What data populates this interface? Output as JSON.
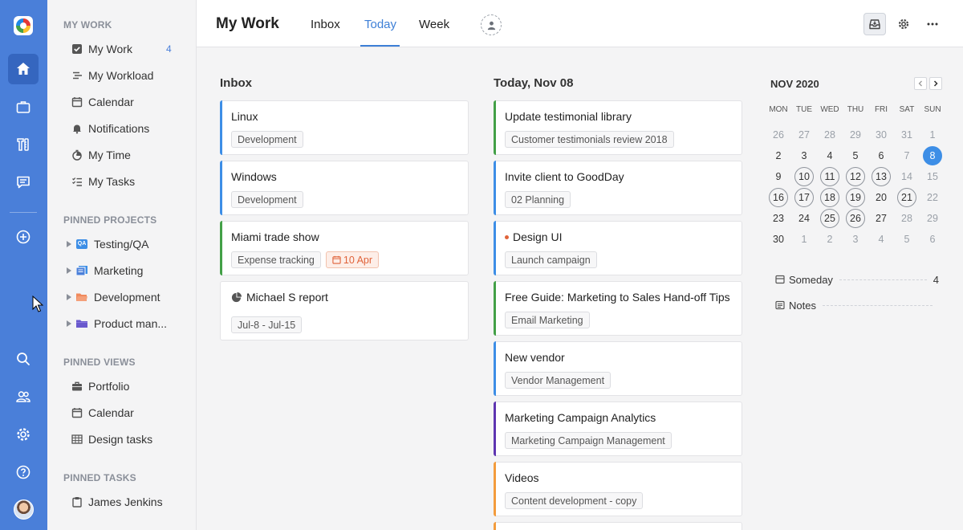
{
  "sidebar": {
    "my_work_header": "MY WORK",
    "my_work_items": [
      {
        "label": "My Work",
        "icon": "check-square-icon",
        "count": "4"
      },
      {
        "label": "My Workload",
        "icon": "workload-icon"
      },
      {
        "label": "Calendar",
        "icon": "calendar-icon"
      },
      {
        "label": "Notifications",
        "icon": "bell-icon"
      },
      {
        "label": "My Time",
        "icon": "stopwatch-icon"
      },
      {
        "label": "My Tasks",
        "icon": "checklist-icon"
      }
    ],
    "pinned_projects_header": "PINNED PROJECTS",
    "pinned_projects": [
      {
        "label": "Testing/QA",
        "icon": "qa-badge-icon",
        "icon_text": "QA"
      },
      {
        "label": "Marketing",
        "icon": "board-icon"
      },
      {
        "label": "Development",
        "icon": "folder-open-icon"
      },
      {
        "label": "Product man...",
        "icon": "folder-icon"
      }
    ],
    "pinned_views_header": "PINNED VIEWS",
    "pinned_views": [
      {
        "label": "Portfolio",
        "icon": "briefcase-icon"
      },
      {
        "label": "Calendar",
        "icon": "calendar-icon"
      },
      {
        "label": "Design tasks",
        "icon": "table-icon"
      }
    ],
    "pinned_tasks_header": "PINNED TASKS",
    "pinned_tasks": [
      {
        "label": "James Jenkins",
        "icon": "clipboard-icon"
      }
    ]
  },
  "header": {
    "title": "My Work",
    "tabs": [
      {
        "label": "Inbox"
      },
      {
        "label": "Today"
      },
      {
        "label": "Week"
      }
    ]
  },
  "inbox": {
    "title": "Inbox",
    "cards": [
      {
        "title": "Linux",
        "tags": [
          "Development"
        ]
      },
      {
        "title": "Windows",
        "tags": [
          "Development"
        ]
      },
      {
        "title": "Miami trade show",
        "tags": [
          "Expense tracking"
        ],
        "due": "10 Apr"
      },
      {
        "title": "Michael S report",
        "tags": [
          "Jul-8 - Jul-15"
        ]
      }
    ]
  },
  "today": {
    "title": "Today, Nov 08",
    "cards": [
      {
        "title": "Update testimonial library",
        "tags": [
          "Customer testimonials review 2018"
        ]
      },
      {
        "title": "Invite client to GoodDay",
        "tags": [
          "02 Planning"
        ]
      },
      {
        "title": "Design UI",
        "tags": [
          "Launch campaign"
        ]
      },
      {
        "title": "Free Guide: Marketing to Sales Hand-off Tips",
        "tags": [
          "Email Marketing"
        ]
      },
      {
        "title": "New vendor",
        "tags": [
          "Vendor Management"
        ]
      },
      {
        "title": "Marketing Campaign Analytics",
        "tags": [
          "Marketing Campaign Management"
        ]
      },
      {
        "title": "Videos",
        "tags": [
          "Content development - copy"
        ]
      }
    ]
  },
  "calendar": {
    "title": "NOV 2020",
    "weekdays": [
      "MON",
      "TUE",
      "WED",
      "THU",
      "FRI",
      "SAT",
      "SUN"
    ],
    "weeks": [
      [
        "26",
        "27",
        "28",
        "29",
        "30",
        "31",
        "1"
      ],
      [
        "2",
        "3",
        "4",
        "5",
        "6",
        "7",
        "8"
      ],
      [
        "9",
        "10",
        "11",
        "12",
        "13",
        "14",
        "15"
      ],
      [
        "16",
        "17",
        "18",
        "19",
        "20",
        "21",
        "22"
      ],
      [
        "23",
        "24",
        "25",
        "26",
        "27",
        "28",
        "29"
      ],
      [
        "30",
        "1",
        "2",
        "3",
        "4",
        "5",
        "6"
      ]
    ],
    "today": "8",
    "marked_days": [
      "10",
      "11",
      "12",
      "13",
      "16",
      "17",
      "18",
      "19",
      "21",
      "25",
      "26"
    ],
    "someday_label": "Someday",
    "someday_count": "4",
    "notes_label": "Notes"
  },
  "colors": {
    "rail": "#4a7fd9",
    "accent": "#3d7fd6",
    "today_badge": "#3d8ee6",
    "bar_blue": "#3d8ee6",
    "bar_green": "#43a047",
    "bar_purple": "#5e35b1",
    "bar_orange": "#f39c3d",
    "due": "#e0633a"
  }
}
